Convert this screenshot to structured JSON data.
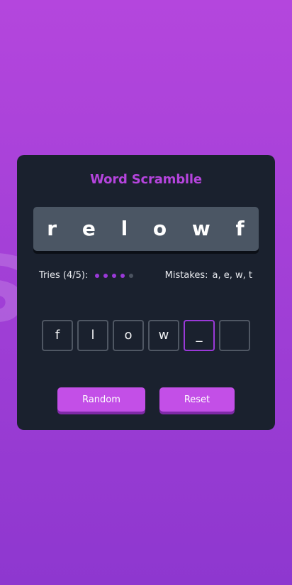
{
  "background_glyph": "S",
  "title": "Word Scramblle",
  "scrambled_word": "r e l o w f",
  "tries": {
    "label": "Tries (4/5):",
    "used": 4,
    "total": 5
  },
  "mistakes": {
    "label": "Mistakes:",
    "letters": "a, e, w, t"
  },
  "slots": [
    "f",
    "l",
    "o",
    "w",
    "_",
    ""
  ],
  "active_slot_index": 4,
  "buttons": {
    "random": "Random",
    "reset": "Reset"
  },
  "colors": {
    "accent": "#b544dd",
    "card": "#1a212e",
    "button": "#c34fe7",
    "word_box": "#4b5664"
  }
}
